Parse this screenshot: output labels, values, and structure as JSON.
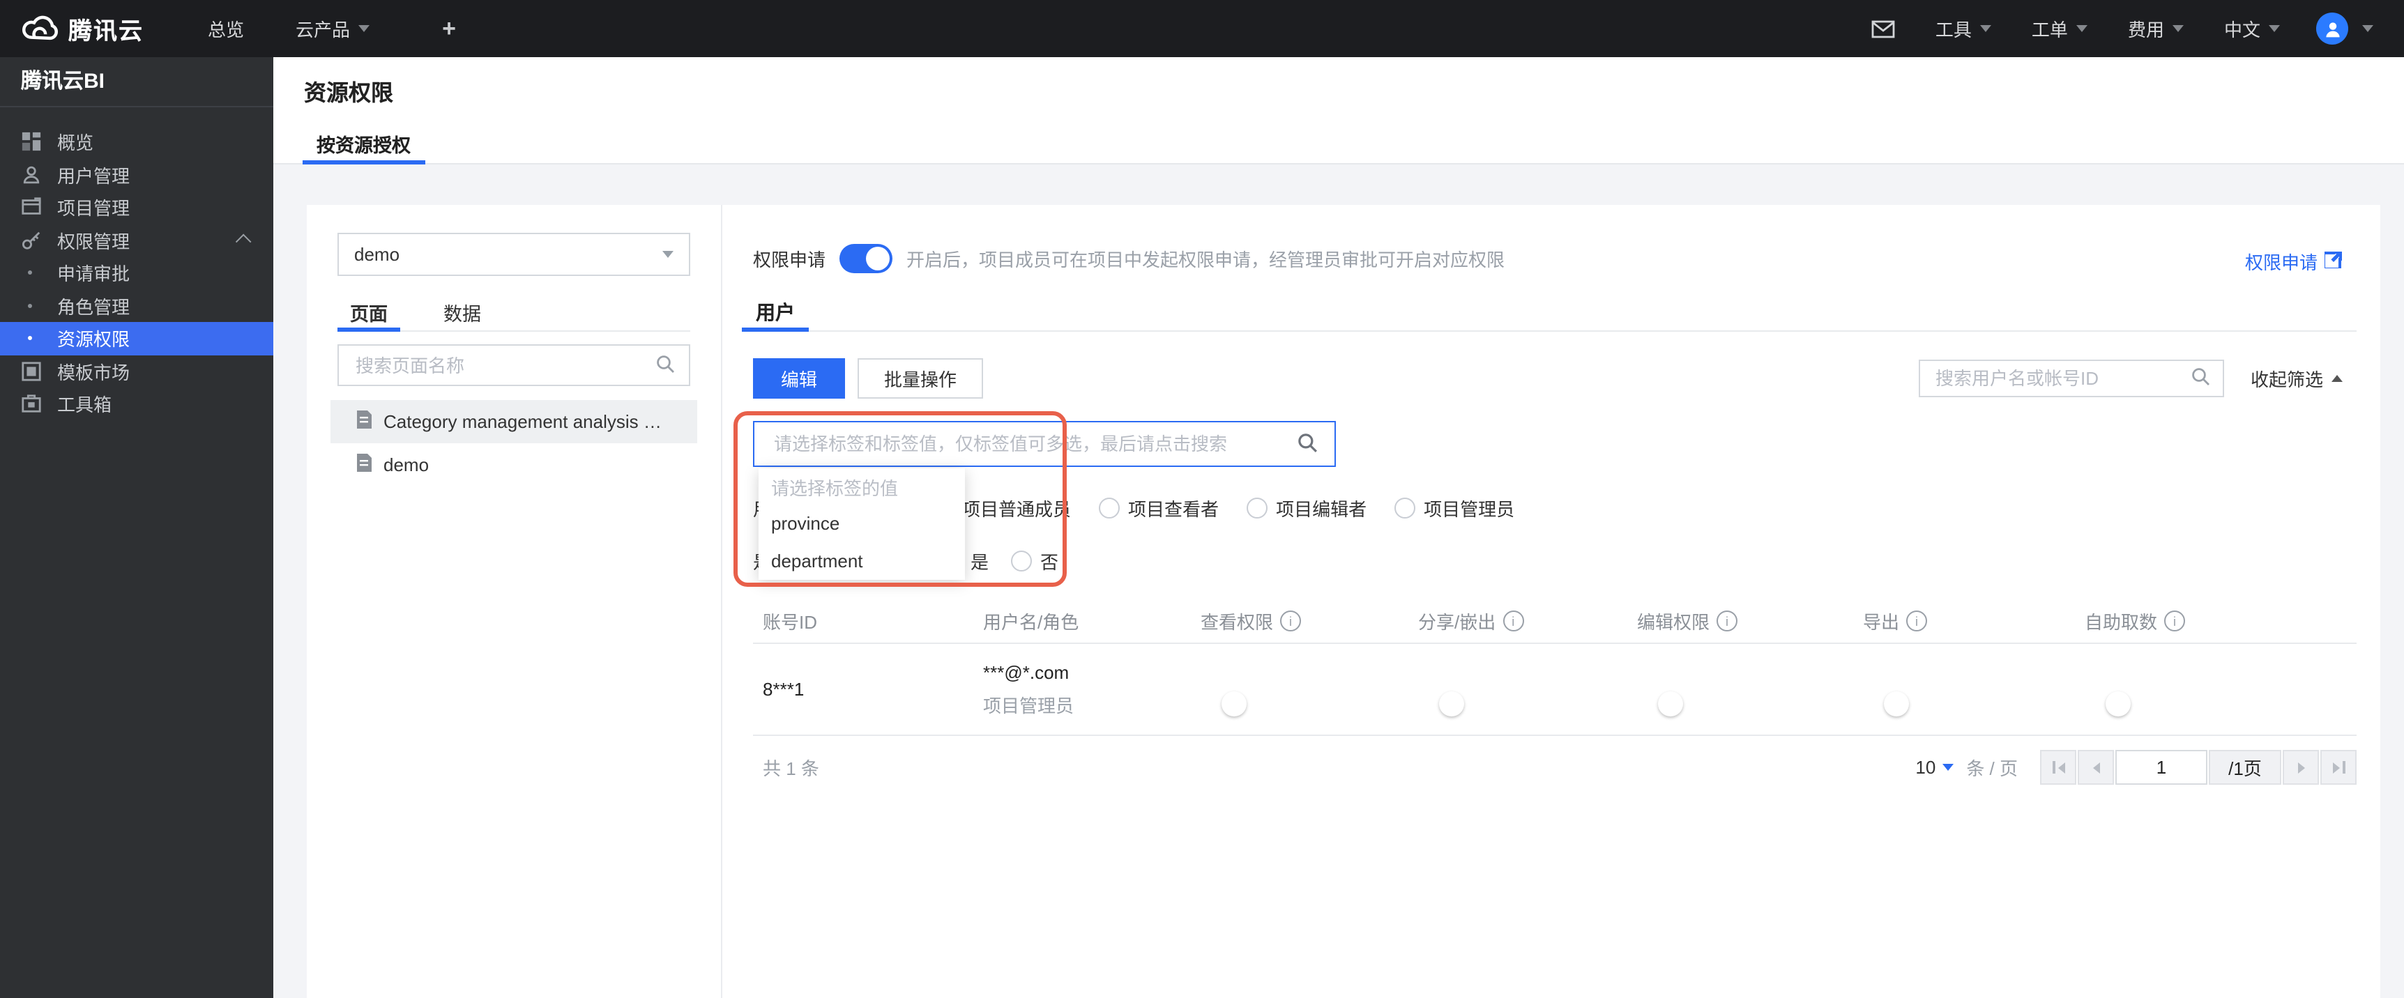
{
  "topbar": {
    "logo_text": "腾讯云",
    "nav_overview": "总览",
    "nav_products": "云产品",
    "plus": "+",
    "menu_tools": "工具",
    "menu_tickets": "工单",
    "menu_billing": "费用",
    "menu_language": "中文"
  },
  "sidebar": {
    "title": "腾讯云BI",
    "items": [
      {
        "label": "概览"
      },
      {
        "label": "用户管理"
      },
      {
        "label": "项目管理"
      },
      {
        "label": "权限管理"
      },
      {
        "label": "申请审批"
      },
      {
        "label": "角色管理"
      },
      {
        "label": "资源权限"
      },
      {
        "label": "模板市场"
      },
      {
        "label": "工具箱"
      }
    ]
  },
  "page": {
    "title": "资源权限",
    "tab": "按资源授权"
  },
  "left_panel": {
    "project_select_value": "demo",
    "tab_pages": "页面",
    "tab_data": "数据",
    "search_placeholder": "搜索页面名称",
    "items": [
      {
        "label": "Category management analysis das..."
      },
      {
        "label": "demo"
      }
    ]
  },
  "main": {
    "permission": {
      "label": "权限申请",
      "desc": "开启后，项目成员可在项目中发起权限申请，经管理员审批可开启对应权限",
      "link_label": "权限申请"
    },
    "user_tab": "用户",
    "toolbar": {
      "edit_label": "编辑",
      "batch_label": "批量操作",
      "user_search_placeholder": "搜索用户名或帐号ID",
      "collapse_filter_label": "收起筛选"
    },
    "tag_search": {
      "placeholder": "请选择标签和标签值，仅标签值可多选，最后请点击搜索"
    },
    "tag_dropdown": {
      "placeholder": "请选择标签的值",
      "options": [
        {
          "label": "province"
        },
        {
          "label": "department"
        }
      ]
    },
    "filter_role": {
      "label_fragment": "用",
      "options": [
        {
          "label": "项目普通成员"
        },
        {
          "label": "项目查看者"
        },
        {
          "label": "项目编辑者"
        },
        {
          "label": "项目管理员"
        }
      ]
    },
    "filter_yesno": {
      "label_fragment": "是",
      "options": [
        {
          "label": "是"
        },
        {
          "label": "否"
        }
      ]
    },
    "table": {
      "columns": [
        {
          "label": "账号ID"
        },
        {
          "label": "用户名/角色"
        },
        {
          "label": "查看权限"
        },
        {
          "label": "分享/嵌出"
        },
        {
          "label": "编辑权限"
        },
        {
          "label": "导出"
        },
        {
          "label": "自助取数"
        }
      ],
      "row": {
        "account_id": "8***1",
        "username": "***@*.com",
        "role": "项目管理员"
      }
    },
    "pagination": {
      "total": "共 1 条",
      "page_size": "10",
      "per_page_suffix": "条 / 页",
      "current_page": "1",
      "total_pages": "/1页"
    }
  },
  "colors": {
    "primary_blue": "#2b6bf3",
    "sidebar_active_blue": "#3c6cf0",
    "toggle_on_light": "#abc7f4",
    "annotation_red": "#e8604a",
    "topbar_bg": "#1c1d20",
    "sidebar_bg": "#2e3033",
    "page_bg": "#f3f4f7"
  }
}
